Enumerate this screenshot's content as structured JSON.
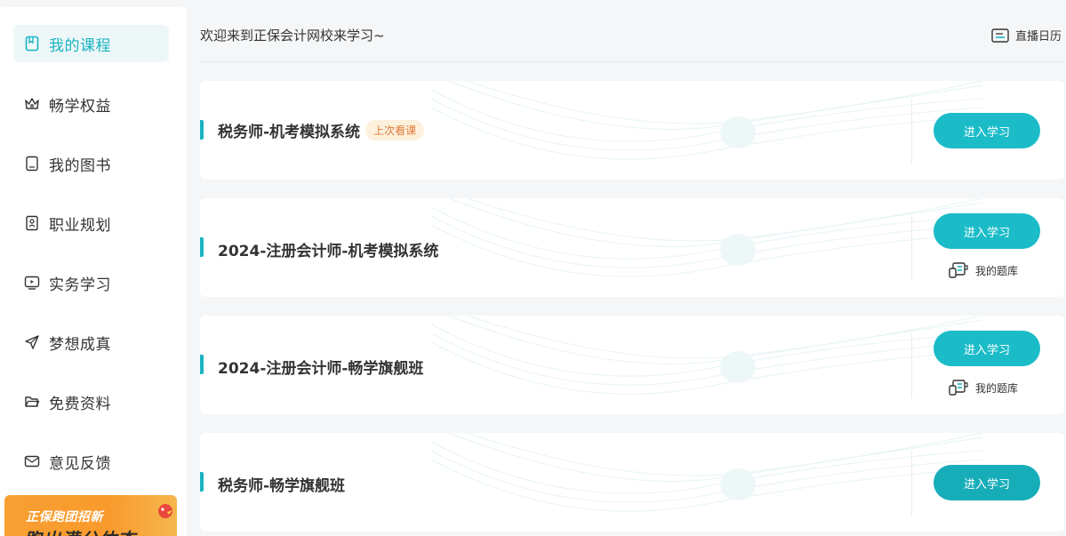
{
  "sidebar": {
    "items": [
      {
        "label": "我的课程",
        "icon": "bookmark-icon",
        "active": true
      },
      {
        "label": "畅学权益",
        "icon": "crown-icon"
      },
      {
        "label": "我的图书",
        "icon": "book-icon"
      },
      {
        "label": "职业规划",
        "icon": "badge-icon"
      },
      {
        "label": "实务学习",
        "icon": "monitor-icon"
      },
      {
        "label": "梦想成真",
        "icon": "paper-plane-icon"
      },
      {
        "label": "免费资料",
        "icon": "folder-icon"
      },
      {
        "label": "意见反馈",
        "icon": "mail-icon"
      }
    ],
    "banner": {
      "line1": "正保跑团招新",
      "line2": "跑出满分体态"
    }
  },
  "header": {
    "welcome": "欢迎来到正保会计网校来学习~",
    "calendar_label": "直播日历"
  },
  "courses": [
    {
      "title": "税务师-机考模拟系统",
      "tag": "上次看课",
      "button": "进入学习"
    },
    {
      "title": "2024-注册会计师-机考模拟系统",
      "button": "进入学习",
      "question_bank": "我的题库"
    },
    {
      "title": "2024-注册会计师-畅学旗舰班",
      "button": "进入学习",
      "question_bank": "我的题库"
    },
    {
      "title": "税务师-畅学旗舰班",
      "button": "进入学习"
    }
  ],
  "colors": {
    "accent": "#1bb3c0",
    "tag_bg": "#fdf0dc",
    "tag_text": "#e07a3b"
  }
}
